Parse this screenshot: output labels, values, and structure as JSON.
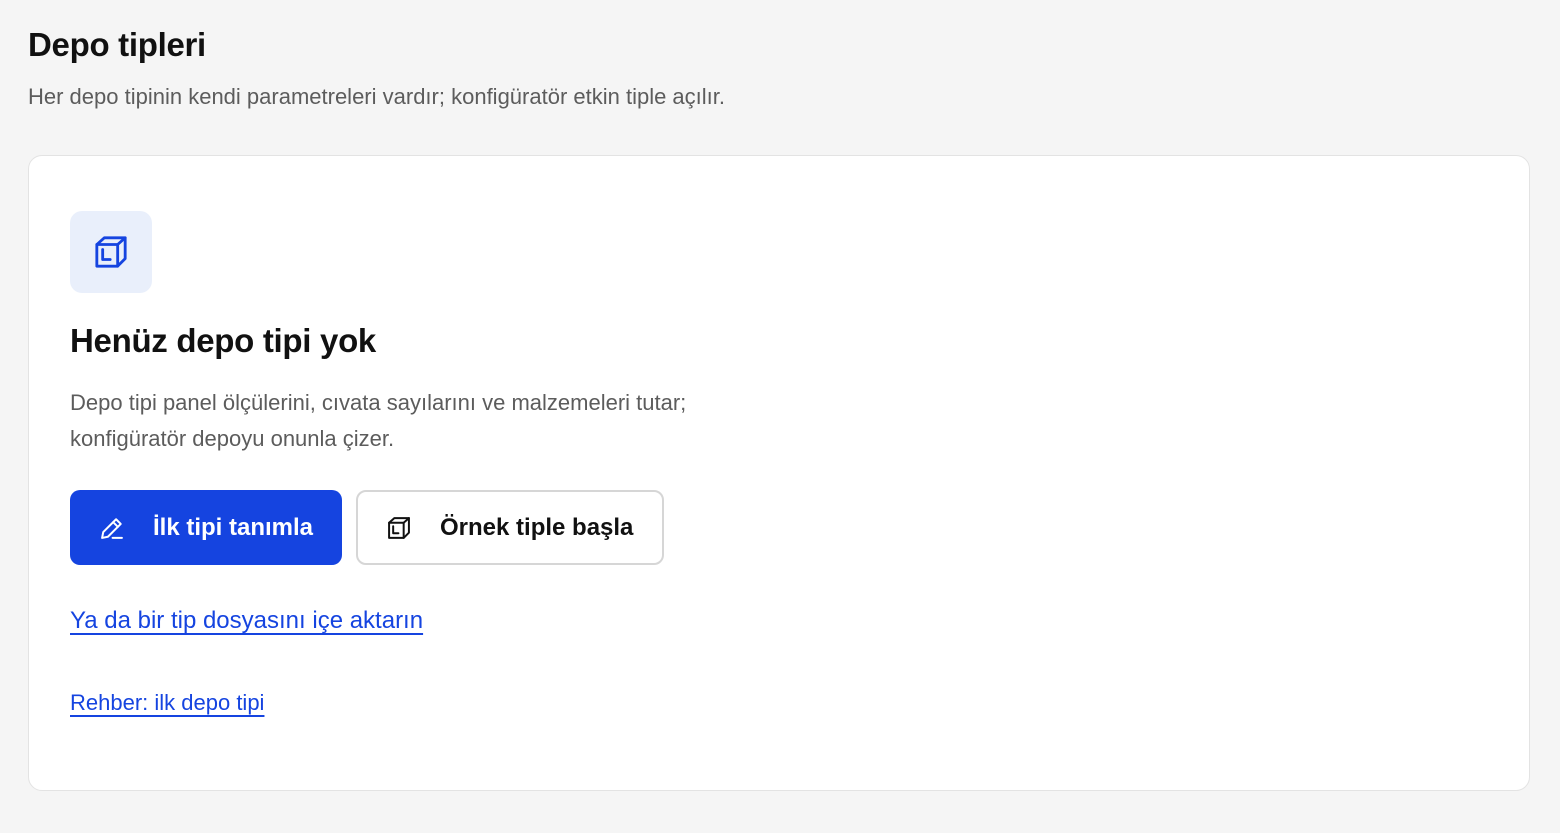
{
  "header": {
    "title": "Depo tipleri",
    "subtitle": "Her depo tipinin kendi parametreleri vardır; konfigüratör etkin tiple açılır."
  },
  "empty_state": {
    "icon": "box-icon",
    "title": "Henüz depo tipi yok",
    "description_lines": [
      "Depo tipi panel ölçülerini, cıvata sayılarını ve malzemeleri tutar;",
      "konfigüratör depoyu onunla çizer."
    ],
    "primary_button": {
      "label": "İlk tipi tanımla",
      "icon": "pencil-icon"
    },
    "secondary_button": {
      "label": "Örnek tiple başla",
      "icon": "box-icon"
    },
    "import_link": "Ya da bir tip dosyasını içe aktarın",
    "guide_link": "Rehber: ilk depo tipi"
  },
  "colors": {
    "accent": "#1544e0",
    "background": "#f5f5f5",
    "card": "#ffffff",
    "icon_tile": "#e9effb",
    "muted_text": "#5c5c5c"
  }
}
